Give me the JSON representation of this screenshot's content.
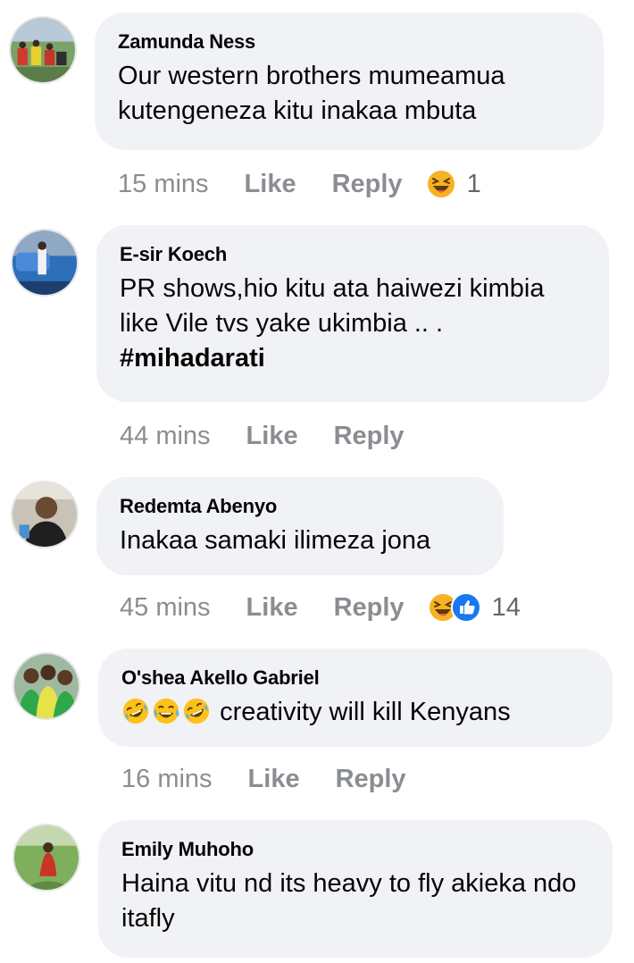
{
  "comments": [
    {
      "author": "Zamunda Ness",
      "text": "Our western brothers  mumeamua kutengeneza kitu inakaa mbuta",
      "time": "15 mins",
      "like": "Like",
      "reply": "Reply",
      "reaction_count": "1",
      "reactions": [
        "laughing-reaction"
      ]
    },
    {
      "author": "E-sir Koech",
      "text": "PR shows,hio kitu ata haiwezi kimbia like Vile tvs yake ukimbia .. .",
      "hashtag": "#mihadarati",
      "time": "44 mins",
      "like": "Like",
      "reply": "Reply"
    },
    {
      "author": "Redemta Abenyo",
      "text": "Inakaa samaki ilimeza jona",
      "time": "45 mins",
      "like": "Like",
      "reply": "Reply",
      "reaction_count": "14",
      "reactions": [
        "laughing-reaction",
        "like-reaction"
      ]
    },
    {
      "author": "O'shea Akello Gabriel",
      "text": "creativity will kill Kenyans",
      "emojis": [
        "rolling-laughing-emoji",
        "tears-of-joy-emoji",
        "rolling-laughing-emoji"
      ],
      "time": "16 mins",
      "like": "Like",
      "reply": "Reply"
    },
    {
      "author": "Emily Muhoho",
      "text": "Haina vitu nd its heavy to fly akieka ndo itafly",
      "time": "",
      "like": "",
      "reply": ""
    }
  ],
  "colors": {
    "bubble": "#f0f2f5",
    "meta": "#8a8d91",
    "like_blue": "#1877f2",
    "haha_yellow": "#f7b125"
  }
}
